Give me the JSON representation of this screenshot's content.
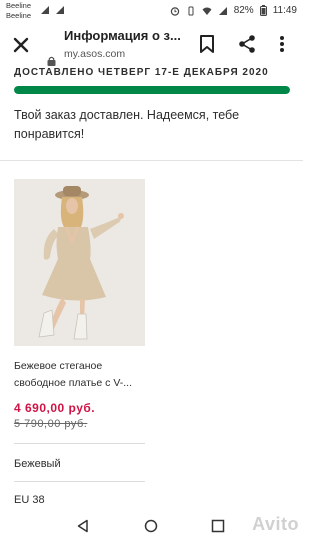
{
  "status_bar": {
    "carrier_1": "Beeline",
    "carrier_2": "Beeline",
    "battery": "82%",
    "time": "11:49"
  },
  "browser": {
    "title": "Информация о з...",
    "url": "my.asos.com"
  },
  "order": {
    "delivered_heading": "ДОСТАВЛЕНО ЧЕТВЕРГ 17-Е ДЕКАБРЯ 2020",
    "progress": 1.0,
    "message": "Твой заказ доставлен. Надеемся, тебе понравится!"
  },
  "product": {
    "name": "Бежевое стеганое свободное платье с V-...",
    "price_now": "4 690,00 руб.",
    "price_was": "5 790,00 руб.",
    "color": "Бежевый",
    "size": "EU 38"
  },
  "colors": {
    "accent_green": "#018849",
    "sale_red": "#d01345"
  },
  "icons": [
    "close-icon",
    "lock-icon",
    "bookmark-icon",
    "share-icon",
    "more-icon",
    "back-icon",
    "home-icon",
    "recents-icon"
  ],
  "watermark": "Avito"
}
